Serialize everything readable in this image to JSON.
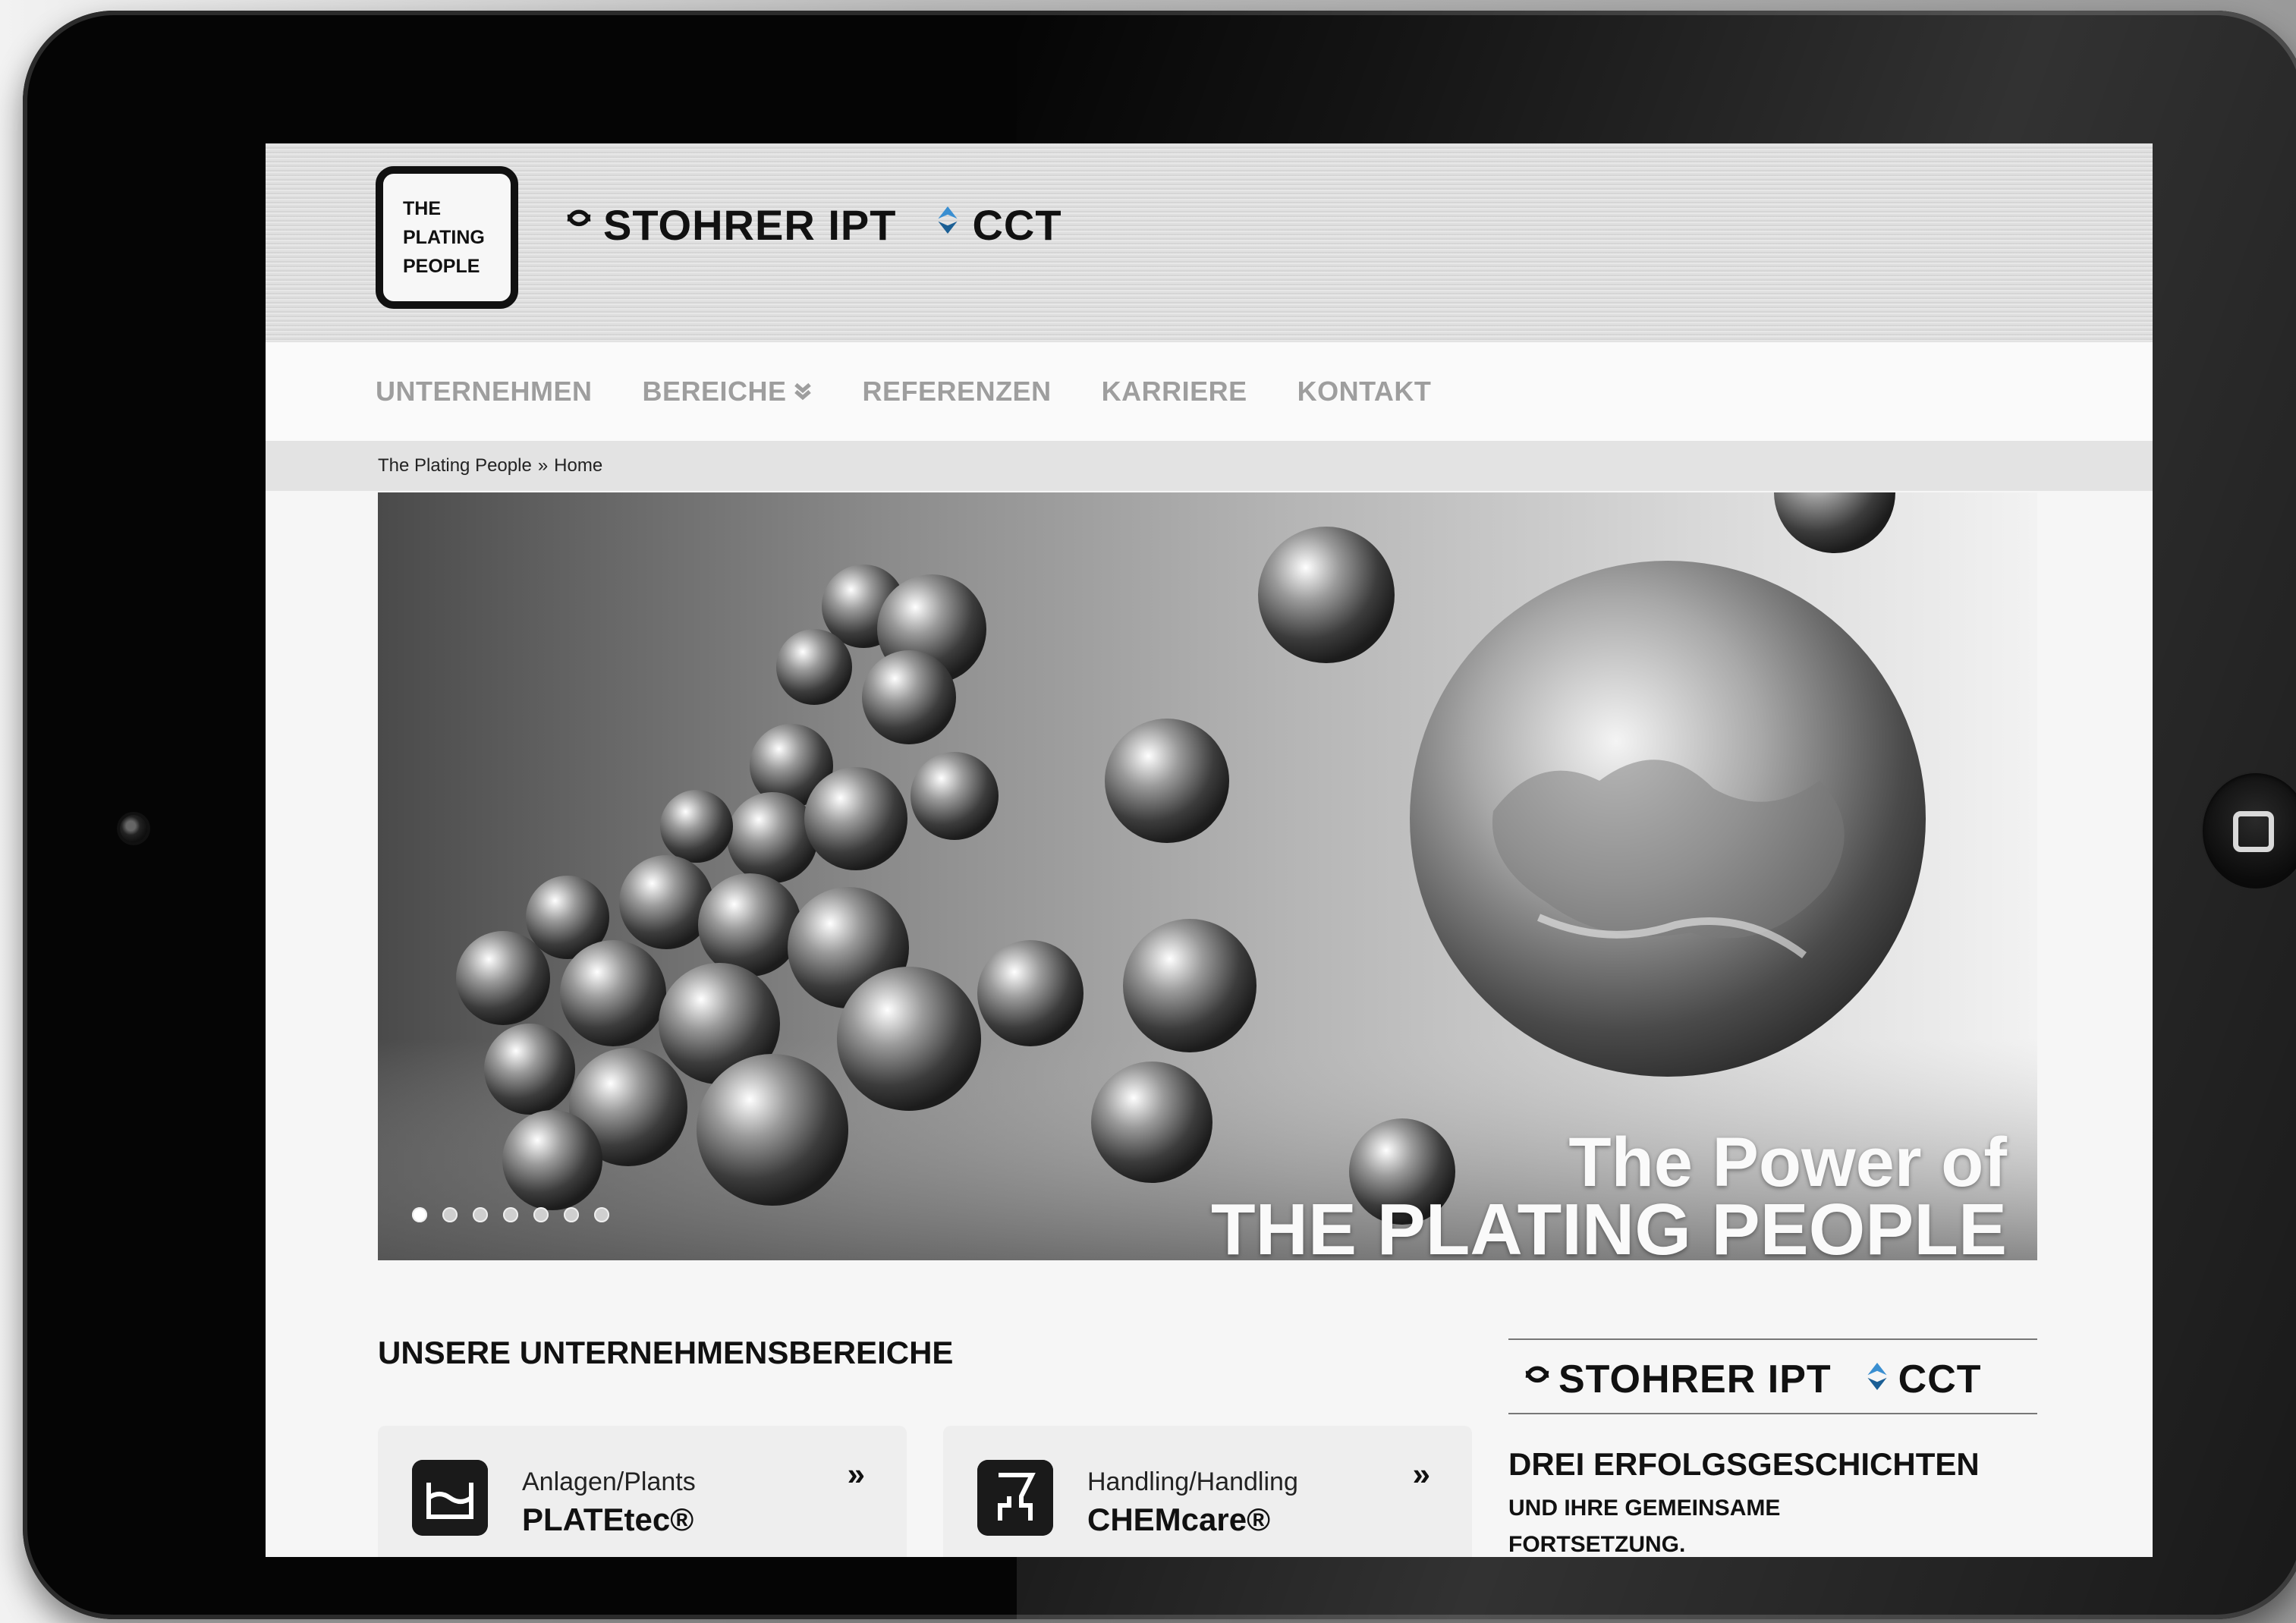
{
  "brand": {
    "box_lines": [
      "THE",
      "PLATING",
      "PEOPLE"
    ],
    "logo_left": "STOHRER IPT",
    "logo_right": "CCT"
  },
  "nav": {
    "items": [
      "UNTERNEHMEN",
      "BEREICHE",
      "REFERENZEN",
      "KARRIERE",
      "KONTAKT"
    ]
  },
  "breadcrumb": {
    "parent": "The Plating People",
    "separator": "»",
    "current": "Home"
  },
  "hero": {
    "line1": "The Power of",
    "line2": "THE PLATING PEOPLE",
    "slide_count": 7,
    "active_slide": 1
  },
  "section": {
    "title": "UNSERE UNTERNEHMENSBEREICHE"
  },
  "cards": [
    {
      "sub": "Anlagen/Plants",
      "title": "PLATEtec®",
      "arrow": "»",
      "icon": "tank-icon"
    },
    {
      "sub": "Handling/Handling",
      "title": "CHEMcare®",
      "arrow": "»",
      "icon": "handling-icon"
    }
  ],
  "side": {
    "logo_left": "STOHRER IPT",
    "logo_right": "CCT",
    "title": "DREI ERFOLGSGESCHICHTEN",
    "text_line1": "UND IHRE GEMEINSAME",
    "text_line2": "FORTSETZUNG."
  },
  "colors": {
    "nav_text": "#9e9e9e",
    "accent_blue": "#3a8fd1",
    "bezel": "#050505"
  }
}
